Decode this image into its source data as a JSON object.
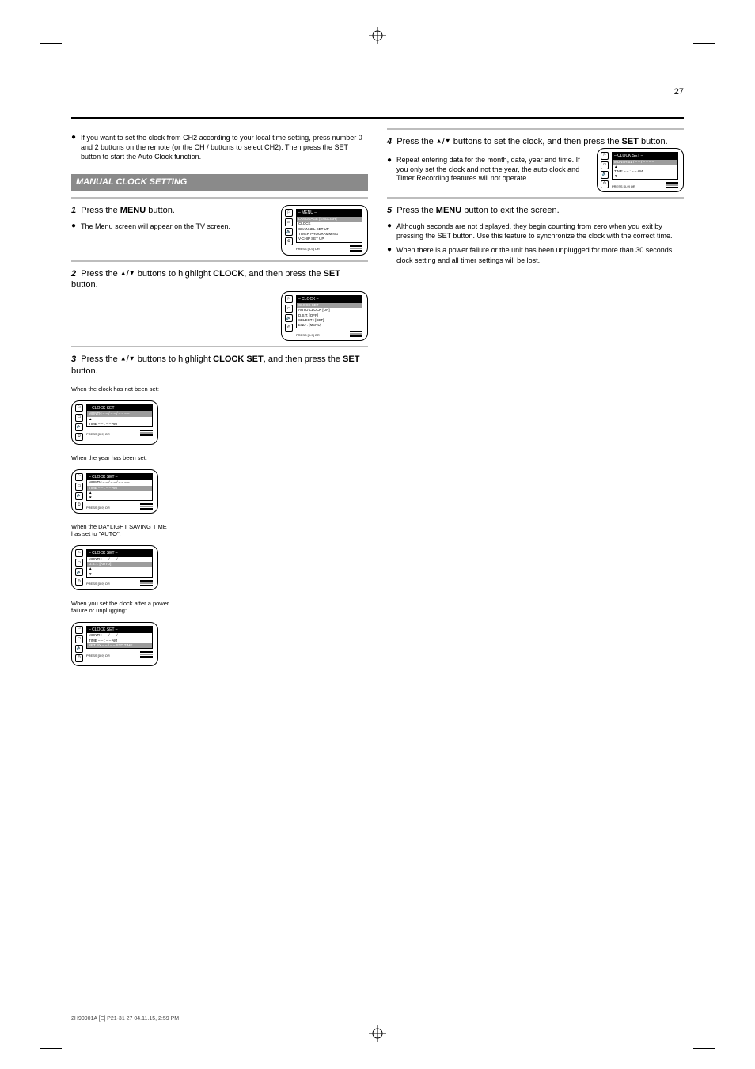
{
  "page_number": "27",
  "left": {
    "intro_note": "If you want to set the clock from CH2 according to your local time setting, press number 0 and 2 buttons on the remote (or the CH / buttons to select CH2). Then press the SET button to start the Auto Clock function.",
    "band_title": "MANUAL CLOCK SETTING",
    "step1_head_num": "1",
    "step1_head_text": "Press the ",
    "step1_head_bold": "MENU",
    "step1_head_after": " button.",
    "step1_note": "The Menu screen will appear on the TV screen.",
    "step2_head_num": "2",
    "step2_head_a": "Press the ",
    "step2_head_b": " buttons to highlight ",
    "step2_head_bold": "CLOCK",
    "step2_head_c": ", and then press the ",
    "step2_head_bold2": "SET",
    "step2_head_d": " button.",
    "step3_head_num": "3",
    "step3_head_a": "Press the ",
    "step3_head_b": " buttons to highlight ",
    "step3_head_bold": "CLOCK SET",
    "step3_head_c": ", and then press the ",
    "step3_head_bold2": "SET",
    "step3_head_d": " button.",
    "tv3a_caption": "When the clock has not been set:",
    "tv3b_caption": "When the year has been set:",
    "tv3c_caption": "When the DAYLIGHT SAVING TIME has set to \"AUTO\":",
    "tv3d_caption": "When you set the clock after a power failure or unplugging:"
  },
  "right": {
    "step4_head_num": "4",
    "step4_head_a": "Press the ",
    "step4_head_b": " buttons to set the clock, and then press the ",
    "step4_head_bold": "SET",
    "step4_head_c": " button.",
    "step4_note": "Repeat entering data for the month, date, year and time. If you only set the clock and not the year, the auto clock and Timer Recording features will not operate.",
    "step5_head_num": "5",
    "step5_head_a": "Press the ",
    "step5_head_bold": "MENU",
    "step5_head_b": " button to exit the screen.",
    "step5_note1": "Although seconds are not displayed, they begin counting from zero when you exit by pressing the SET button. Use this feature to synchronize the clock with the correct time.",
    "step5_note2": "When there is a power failure or the unit has been unplugged for more than 30 seconds, clock setting and all timer settings will be lost."
  },
  "tv": {
    "menu_title": "– MENU –",
    "items": [
      "LANGUAGE [ENGLISH]",
      "CLOCK",
      "CHANNEL SET UP",
      "TIMER PROGRAMMING",
      "V-CHIP SET UP"
    ],
    "select_hint": "SELECT : [SET]",
    "end_hint": "END : [MENU]",
    "clock_title": "– CLOCK –",
    "clock_items": [
      "CLOCK SET",
      "AUTO CLOCK [ON]",
      "D.S.T. [OFF]"
    ],
    "clockset_title": "– CLOCK SET –",
    "month_line": "MONTH   – – / – – / – – – –",
    "time_line": "TIME   – – : – – AM",
    "month_line_val": "MONTH   01 / – – / – – – –",
    "dst_line": "D.S.T.     [AUTO]",
    "set_by_hint": "SET BY    – – / – – STD TIME",
    "remote_label": "PRESS [0-9]\nOR",
    "icon_names": [
      "flag-icon",
      "rect-icon",
      "speaker-icon",
      "clock-icon"
    ]
  },
  "footer": "2H90901A [E] P21-31   27   04.11.15, 2:59 PM"
}
